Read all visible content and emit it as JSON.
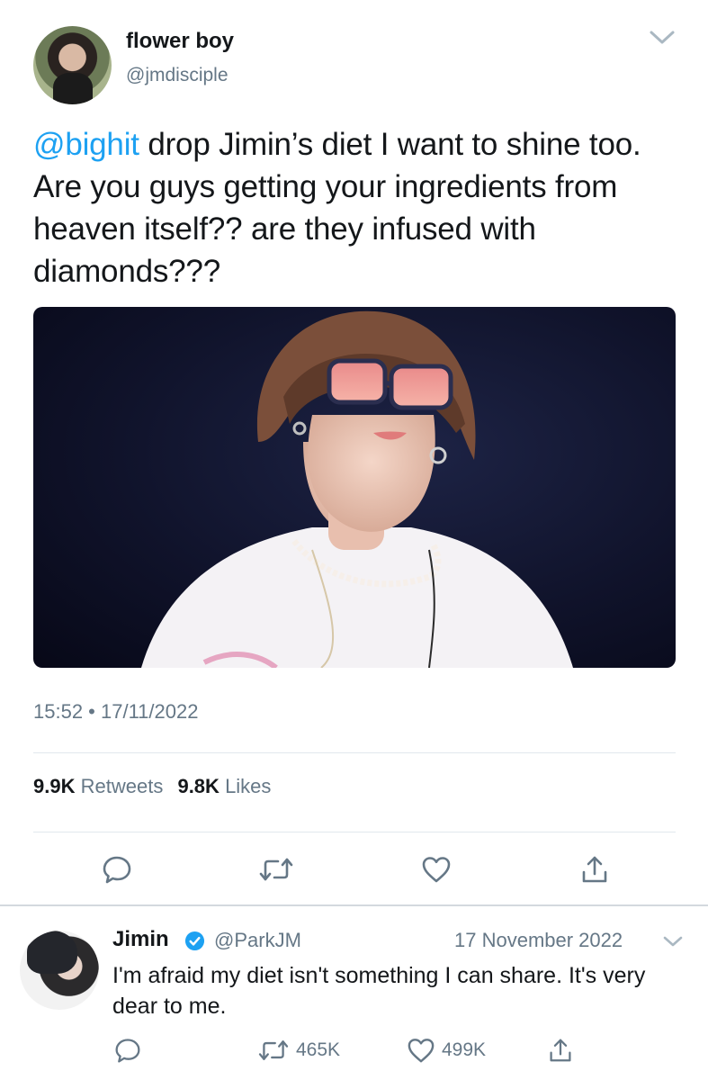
{
  "tweet": {
    "display_name": "flower boy",
    "handle": "@jmdisciple",
    "mention": "@bighit",
    "text_rest": " drop Jimin’s diet I want to shine too. Are you guys getting your ingredients from heaven itself?? are they infused with diamonds???",
    "timestamp": "15:52 • 17/11/2022",
    "stats": {
      "retweets_count": "9.9K",
      "retweets_label": "Retweets",
      "likes_count": "9.8K",
      "likes_label": "Likes"
    },
    "icons": [
      "chevron-down-icon",
      "reply-icon",
      "retweet-icon",
      "like-icon",
      "share-icon"
    ]
  },
  "reply": {
    "display_name": "Jimin",
    "handle": "@ParkJM",
    "date": "17 November 2022",
    "text": "I'm afraid my diet isn't something I can share. It's very dear to me.",
    "retweets": "465K",
    "likes": "499K",
    "icons": [
      "verified-badge-icon",
      "chevron-down-icon",
      "reply-icon",
      "retweet-icon",
      "like-icon",
      "share-icon"
    ]
  },
  "colors": {
    "accent": "#1da1f2",
    "secondary_text": "#657786",
    "primary_text": "#14171a",
    "divider": "#e1e8ed"
  }
}
